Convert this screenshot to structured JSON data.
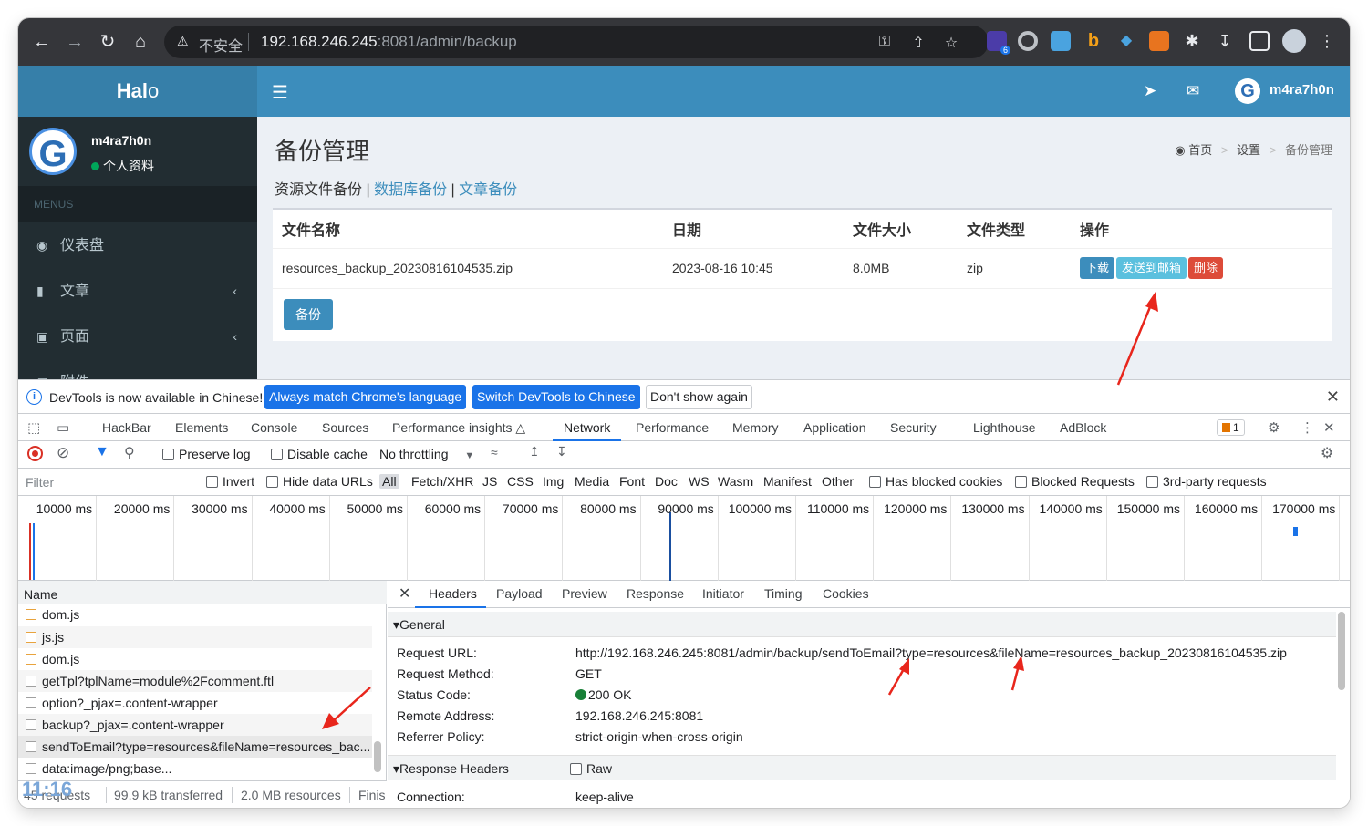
{
  "browser": {
    "security_label": "不安全",
    "url_host": "192.168.246.245",
    "url_rest": ":8081/admin/backup",
    "extension_badge": "6"
  },
  "header": {
    "logo_bold": "Hal",
    "logo_light": "o",
    "username": "m4ra7h0n"
  },
  "sidebar": {
    "username": "m4ra7h0n",
    "status": "个人资料",
    "menus_label": "MENUS",
    "items": [
      {
        "label": "仪表盘"
      },
      {
        "label": "文章"
      },
      {
        "label": "页面"
      },
      {
        "label": "附件"
      }
    ]
  },
  "content": {
    "title": "备份管理",
    "breadcrumb": {
      "home": "首页",
      "settings": "设置",
      "current": "备份管理"
    },
    "subtabs": {
      "resource": "资源文件备份",
      "database": "数据库备份",
      "posts": "文章备份",
      "separator": "|"
    },
    "table": {
      "columns": [
        "文件名称",
        "日期",
        "文件大小",
        "文件类型",
        "操作"
      ],
      "rows": [
        {
          "name": "resources_backup_20230816104535.zip",
          "date": "2023-08-16 10:45",
          "size": "8.0MB",
          "type": "zip"
        }
      ],
      "actions": {
        "download": "下载",
        "send_email": "发送到邮箱",
        "delete": "删除"
      }
    },
    "backup_button": "备份"
  },
  "devtools": {
    "infobar": {
      "message": "DevTools is now available in Chinese!",
      "match_language": "Always match Chrome's language",
      "switch_chinese": "Switch DevTools to Chinese",
      "dont_show": "Don't show again"
    },
    "tabs": [
      "HackBar",
      "Elements",
      "Console",
      "Sources",
      "Performance insights",
      "Network",
      "Performance",
      "Memory",
      "Application",
      "Security",
      "Lighthouse",
      "AdBlock"
    ],
    "active_tab": "Network",
    "issues_count": "1",
    "toolbar": {
      "preserve_log": "Preserve log",
      "disable_cache": "Disable cache",
      "throttling": "No throttling"
    },
    "filter": {
      "placeholder": "Filter",
      "invert": "Invert",
      "hide_data_urls": "Hide data URLs",
      "types": [
        "All",
        "Fetch/XHR",
        "JS",
        "CSS",
        "Img",
        "Media",
        "Font",
        "Doc",
        "WS",
        "Wasm",
        "Manifest",
        "Other"
      ],
      "has_blocked_cookies": "Has blocked cookies",
      "blocked_requests": "Blocked Requests",
      "third_party": "3rd-party requests"
    },
    "timeline_labels": [
      "10000 ms",
      "20000 ms",
      "30000 ms",
      "40000 ms",
      "50000 ms",
      "60000 ms",
      "70000 ms",
      "80000 ms",
      "90000 ms",
      "100000 ms",
      "110000 ms",
      "120000 ms",
      "130000 ms",
      "140000 ms",
      "150000 ms",
      "160000 ms",
      "170000 ms"
    ],
    "request_list": {
      "header": "Name",
      "rows": [
        {
          "name": "dom.js",
          "kind": "js"
        },
        {
          "name": "js.js",
          "kind": "js"
        },
        {
          "name": "dom.js",
          "kind": "js"
        },
        {
          "name": "getTpl?tplName=module%2Fcomment.ftl",
          "kind": "doc"
        },
        {
          "name": "option?_pjax=.content-wrapper",
          "kind": "doc"
        },
        {
          "name": "backup?_pjax=.content-wrapper",
          "kind": "doc"
        },
        {
          "name": "sendToEmail?type=resources&fileName=resources_bac...",
          "kind": "doc"
        },
        {
          "name": "data:image/png;base...",
          "kind": "doc"
        }
      ]
    },
    "status": {
      "requests": "45 requests",
      "transferred": "99.9 kB transferred",
      "resources": "2.0 MB resources",
      "finish": "Finis"
    },
    "overlay_time": "11:16",
    "details": {
      "tabs": [
        "Headers",
        "Payload",
        "Preview",
        "Response",
        "Initiator",
        "Timing",
        "Cookies"
      ],
      "general_label": "General",
      "general": [
        {
          "key": "Request URL:",
          "value": "http://192.168.246.245:8081/admin/backup/sendToEmail?type=resources&fileName=resources_backup_20230816104535.zip"
        },
        {
          "key": "Request Method:",
          "value": "GET"
        },
        {
          "key": "Status Code:",
          "value": "200 OK"
        },
        {
          "key": "Remote Address:",
          "value": "192.168.246.245:8081"
        },
        {
          "key": "Referrer Policy:",
          "value": "strict-origin-when-cross-origin"
        }
      ],
      "response_headers_label": "Response Headers",
      "raw_label": "Raw",
      "response_headers": [
        {
          "key": "Connection:",
          "value": "keep-alive"
        }
      ]
    }
  },
  "colors": {
    "halo_blue": "#3c8dbc",
    "sidebar_bg": "#222d32",
    "devtools_accent": "#1a73e8",
    "annotation_red": "#e8261c"
  }
}
